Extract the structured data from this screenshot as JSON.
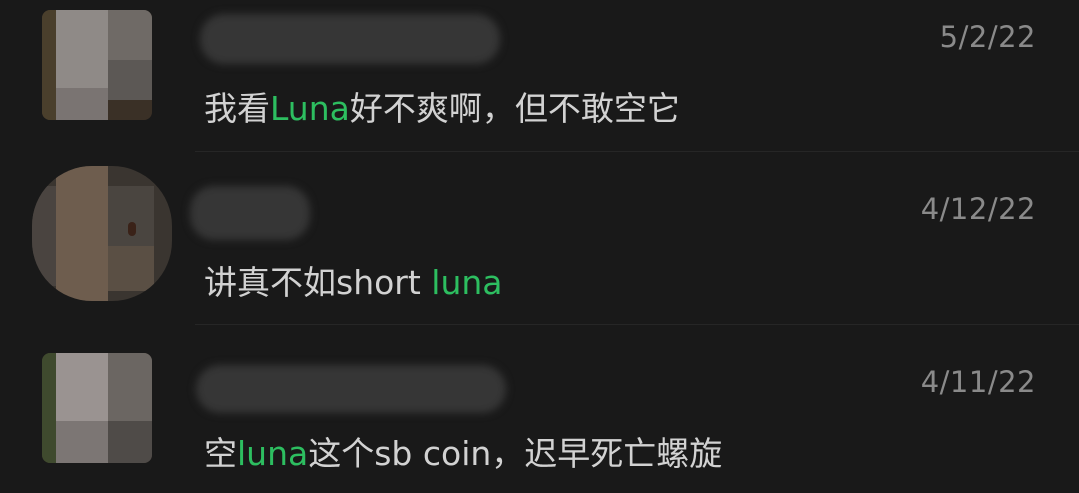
{
  "results": [
    {
      "date": "5/2/22",
      "message": {
        "before": "我看",
        "highlight": "Luna",
        "after": "好不爽啊，但不敢空它"
      }
    },
    {
      "date": "4/12/22",
      "message": {
        "before": "讲真不如short ",
        "highlight": "luna",
        "after": ""
      }
    },
    {
      "date": "4/11/22",
      "message": {
        "before": "空",
        "highlight": "luna",
        "after": "这个sb coin，迟早死亡螺旋"
      }
    }
  ],
  "colors": {
    "background": "#191919",
    "highlight": "#2dbe60",
    "text": "#d2d2d2",
    "date": "#8a8a8a"
  }
}
